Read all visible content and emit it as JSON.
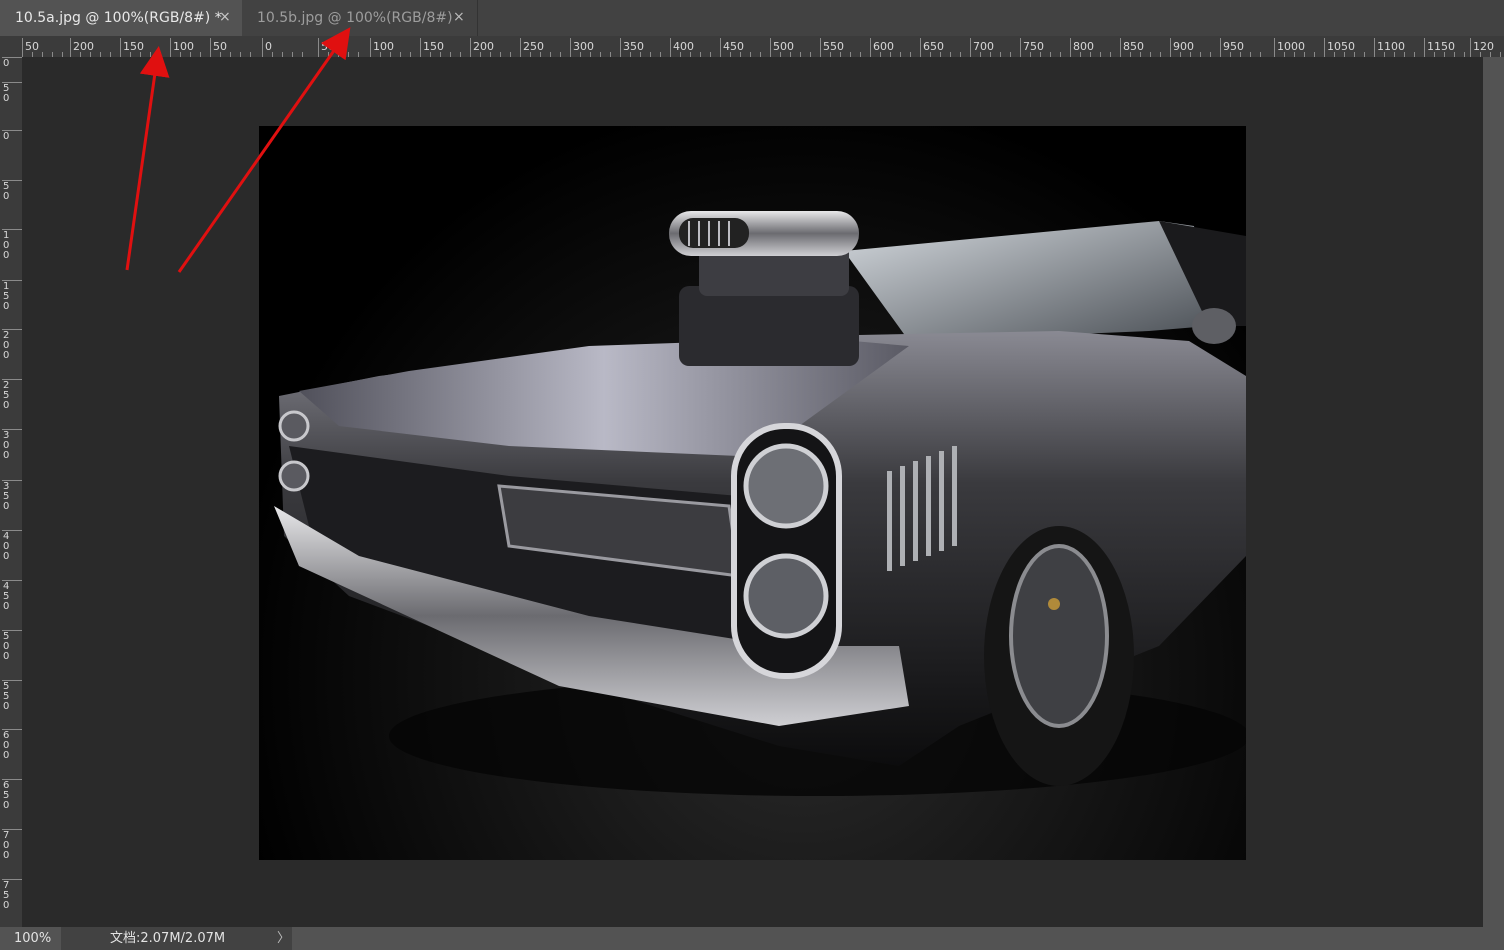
{
  "tabs": [
    {
      "label": "10.5a.jpg @ 100%(RGB/8#) *",
      "close": "×",
      "active": true
    },
    {
      "label": "10.5b.jpg @ 100%(RGB/8#)",
      "close": "×",
      "active": false
    }
  ],
  "ruler_h": {
    "labels": [
      "50",
      "200",
      "150",
      "100",
      "50",
      "0",
      "50",
      "100",
      "150",
      "200",
      "250",
      "300",
      "350",
      "400",
      "450",
      "500",
      "550",
      "600",
      "650",
      "700",
      "750",
      "800",
      "850",
      "900",
      "950",
      "1000",
      "1050",
      "1100",
      "1150",
      "120"
    ]
  },
  "ruler_v": {
    "labels": [
      "0",
      "50",
      "0",
      "50",
      "100",
      "150",
      "200",
      "250",
      "300",
      "350",
      "400",
      "450",
      "500",
      "550",
      "600",
      "650",
      "700",
      "750"
    ]
  },
  "status": {
    "zoom": "100%",
    "doc": "文档:2.07M/2.07M",
    "arrow": "〉"
  },
  "colors": {
    "arrow": "#e01010",
    "canvas": "#2a2a2a",
    "ui": "#535353"
  }
}
